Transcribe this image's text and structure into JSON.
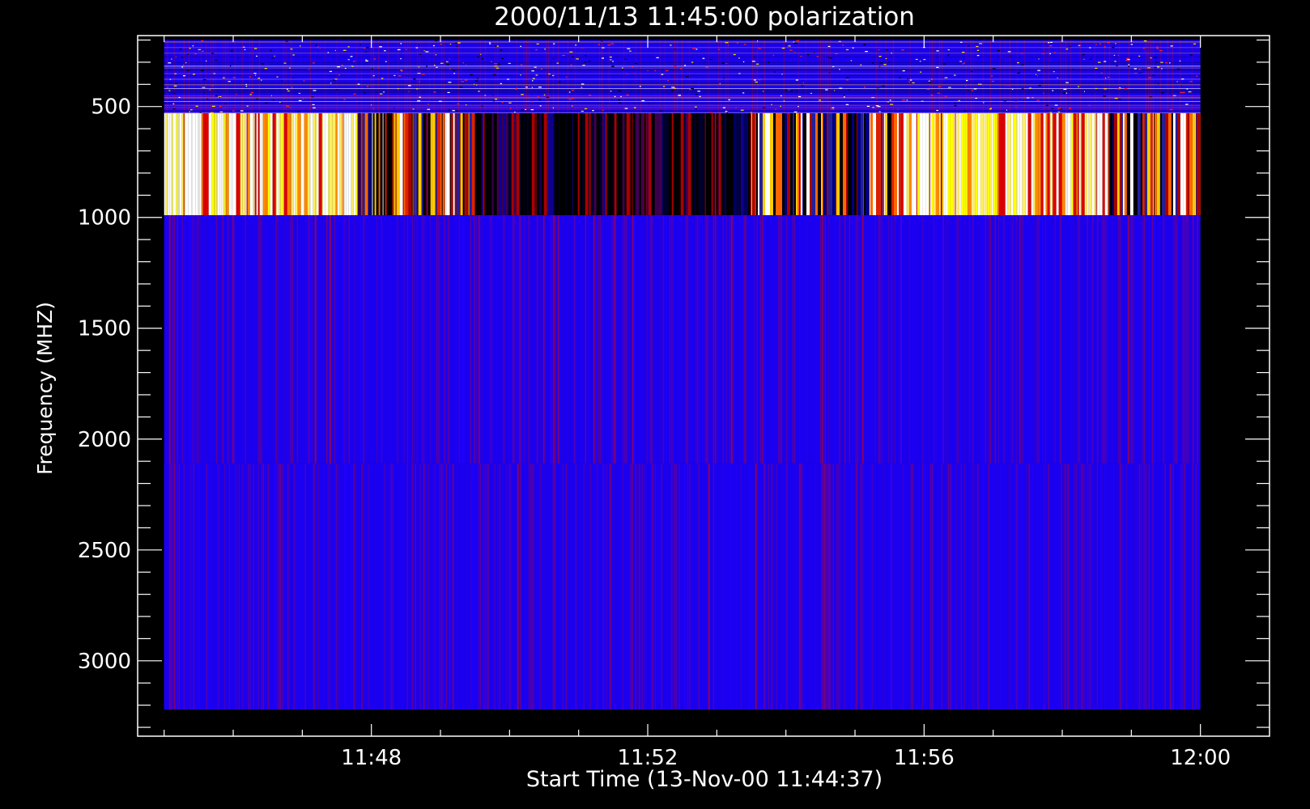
{
  "chart_data": {
    "type": "heatmap",
    "title": "2000/11/13 11:45:00 polarization",
    "xlabel": "Start Time (13-Nov-00 11:44:37)",
    "ylabel": "Frequency (MHZ)",
    "y_inverted": true,
    "ylim": [
      180,
      3340
    ],
    "xlim": [
      "11:44:37",
      "12:01:00"
    ],
    "data_extent_x": [
      "11:45:00",
      "12:00:00"
    ],
    "data_extent_y": [
      200,
      3220
    ],
    "x_ticks": [
      "11:48",
      "11:52",
      "11:56",
      "12:00"
    ],
    "y_ticks": [
      500,
      1000,
      1500,
      2000,
      2500,
      3000
    ],
    "colormap": [
      "#000000",
      "#0000ff",
      "#cc0000",
      "#ff6600",
      "#ffff00",
      "#ffffff"
    ],
    "bands": [
      {
        "freq_range": [
          200,
          530
        ],
        "pattern": "noisy blue with scattered red, white and black channels"
      },
      {
        "freq_range": [
          530,
          990
        ],
        "pattern": "strong polarization: white/yellow segments 11:45-11:47:50 and 11:55:40-12:00, dark with red streaks 11:48-11:55"
      },
      {
        "freq_range": [
          990,
          2110
        ],
        "pattern": "blue with fine red vertical striations"
      },
      {
        "freq_range": [
          2110,
          3220
        ],
        "pattern": "blue with fine red vertical striations"
      }
    ],
    "strong_band_segments": [
      {
        "start": "11:45:00",
        "end": "11:47:48",
        "level": "high"
      },
      {
        "start": "11:47:48",
        "end": "11:48:45",
        "level": "mixed"
      },
      {
        "start": "11:48:45",
        "end": "11:49:30",
        "level": "mixed"
      },
      {
        "start": "11:49:30",
        "end": "11:53:30",
        "level": "low"
      },
      {
        "start": "11:53:30",
        "end": "11:55:40",
        "level": "mixed"
      },
      {
        "start": "11:55:40",
        "end": "11:57:00",
        "level": "high"
      },
      {
        "start": "11:57:00",
        "end": "11:58:40",
        "level": "high"
      },
      {
        "start": "11:58:40",
        "end": "12:00:00",
        "level": "mixed"
      }
    ]
  }
}
